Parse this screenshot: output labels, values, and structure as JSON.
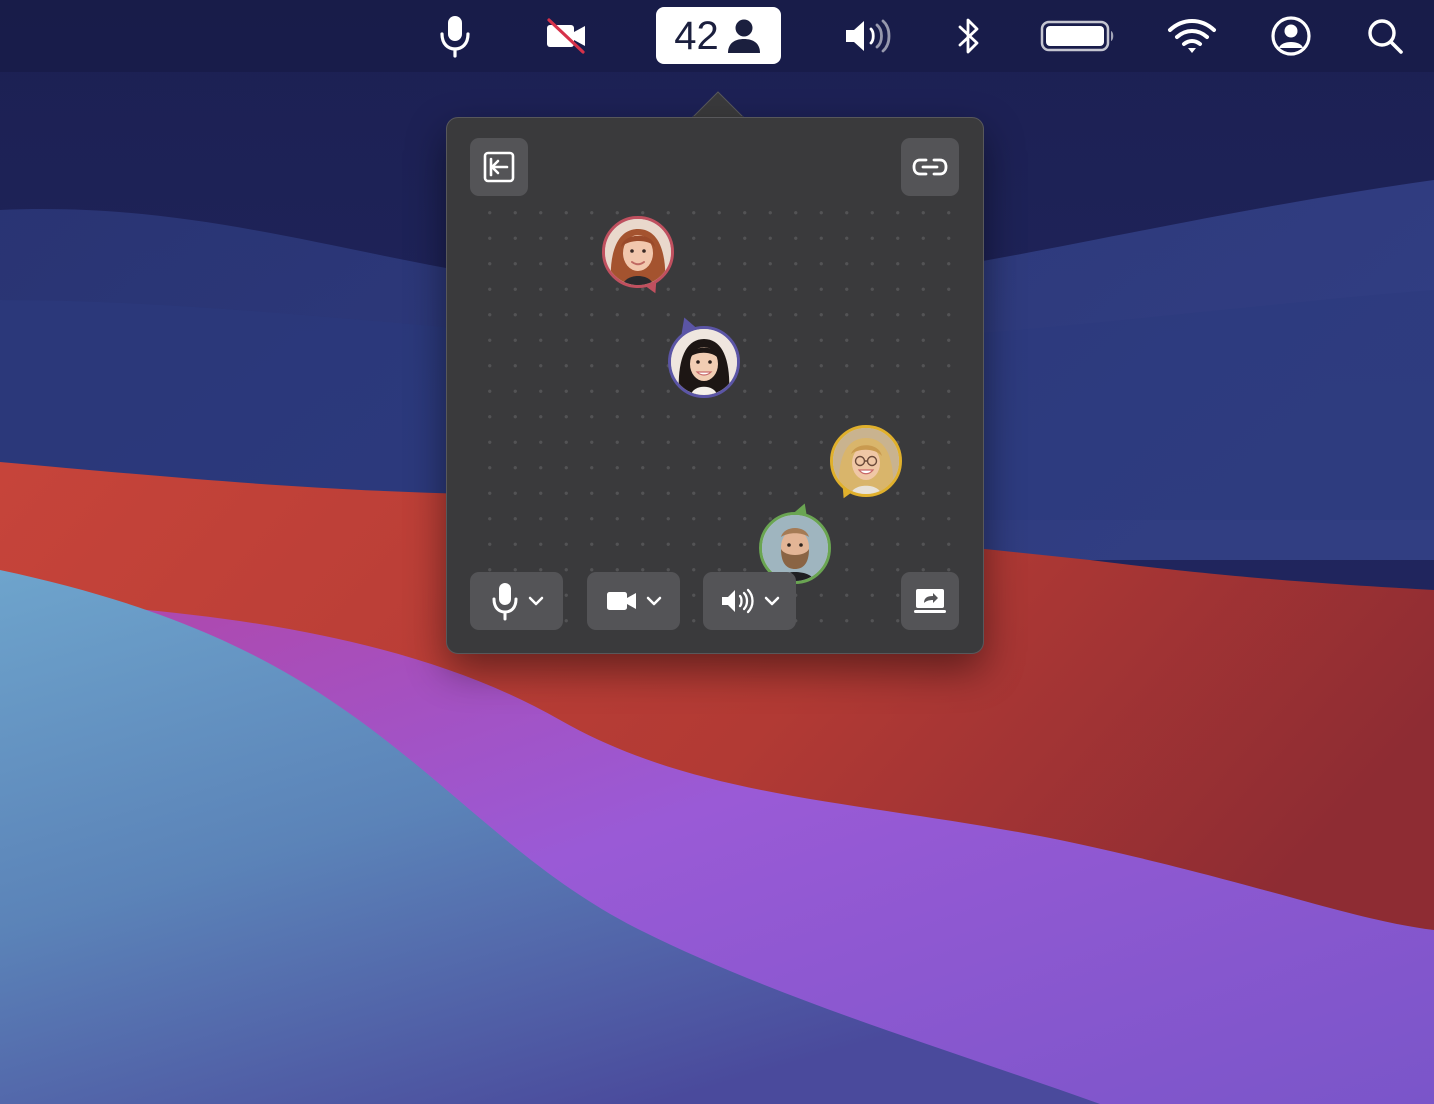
{
  "menubar": {
    "participant_count": "42",
    "icons": [
      "microphone-icon",
      "video-off-icon",
      "person-icon",
      "speaker-icon",
      "bluetooth-icon",
      "battery-icon",
      "wifi-icon",
      "user-account-icon",
      "search-icon"
    ]
  },
  "popover": {
    "top_left_button": "leave-icon",
    "top_right_button": "link-icon",
    "participants": [
      {
        "id": "woman-red-hair",
        "ring_color": "#c0505f"
      },
      {
        "id": "woman-dark-hair",
        "ring_color": "#5b55a6"
      },
      {
        "id": "woman-glasses",
        "ring_color": "#e0b02c"
      },
      {
        "id": "man-beard",
        "ring_color": "#6aa552"
      }
    ],
    "controls": [
      {
        "id": "microphone",
        "icon": "microphone-icon",
        "has_dropdown": true
      },
      {
        "id": "camera",
        "icon": "video-camera-icon",
        "has_dropdown": true
      },
      {
        "id": "speaker",
        "icon": "speaker-icon",
        "has_dropdown": true
      },
      {
        "id": "screen-share",
        "icon": "screen-share-icon",
        "has_dropdown": false
      }
    ]
  },
  "colors": {
    "popover_bg": "#3a3a3c",
    "button_bg": "#545457",
    "wallpaper_top": "#1f2256",
    "wallpaper_red": "#b8453b",
    "wallpaper_purple": "#8a5bd1",
    "wallpaper_blue": "#5b8fbf"
  }
}
